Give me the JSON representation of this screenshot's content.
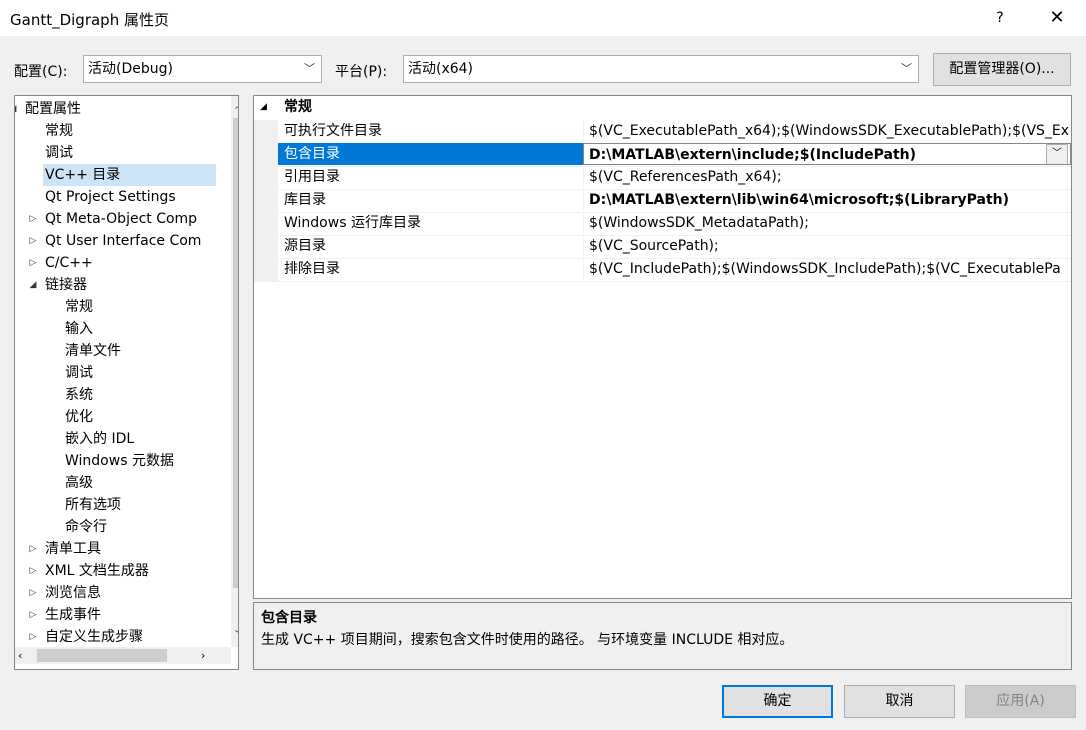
{
  "window": {
    "title": "Gantt_Digraph 属性页",
    "help": "?",
    "close": "✕"
  },
  "config": {
    "label": "配置(C):",
    "value": "活动(Debug)",
    "platform_label": "平台(P):",
    "platform_value": "活动(x64)",
    "manager_button": "配置管理器(O)..."
  },
  "tree": [
    {
      "label": "配置属性",
      "level": 0,
      "expander": "◢"
    },
    {
      "label": "常规",
      "level": 1,
      "expander": ""
    },
    {
      "label": "调试",
      "level": 1,
      "expander": ""
    },
    {
      "label": "VC++ 目录",
      "level": 1,
      "expander": "",
      "selected": true
    },
    {
      "label": "Qt Project Settings",
      "level": 1,
      "expander": ""
    },
    {
      "label": "Qt Meta-Object Comp",
      "level": 1,
      "expander": "▷"
    },
    {
      "label": "Qt User Interface Com",
      "level": 1,
      "expander": "▷"
    },
    {
      "label": "C/C++",
      "level": 1,
      "expander": "▷"
    },
    {
      "label": "链接器",
      "level": 1,
      "expander": "◢"
    },
    {
      "label": "常规",
      "level": 2,
      "expander": ""
    },
    {
      "label": "输入",
      "level": 2,
      "expander": ""
    },
    {
      "label": "清单文件",
      "level": 2,
      "expander": ""
    },
    {
      "label": "调试",
      "level": 2,
      "expander": ""
    },
    {
      "label": "系统",
      "level": 2,
      "expander": ""
    },
    {
      "label": "优化",
      "level": 2,
      "expander": ""
    },
    {
      "label": "嵌入的 IDL",
      "level": 2,
      "expander": ""
    },
    {
      "label": "Windows 元数据",
      "level": 2,
      "expander": ""
    },
    {
      "label": "高级",
      "level": 2,
      "expander": ""
    },
    {
      "label": "所有选项",
      "level": 2,
      "expander": ""
    },
    {
      "label": "命令行",
      "level": 2,
      "expander": ""
    },
    {
      "label": "清单工具",
      "level": 1,
      "expander": "▷"
    },
    {
      "label": "XML 文档生成器",
      "level": 1,
      "expander": "▷"
    },
    {
      "label": "浏览信息",
      "level": 1,
      "expander": "▷"
    },
    {
      "label": "生成事件",
      "level": 1,
      "expander": "▷"
    },
    {
      "label": "自定义生成步骤",
      "level": 1,
      "expander": "▷"
    }
  ],
  "grid": {
    "category": "常规",
    "category_toggle": "◢",
    "rows": [
      {
        "name": "可执行文件目录",
        "value": "$(VC_ExecutablePath_x64);$(WindowsSDK_ExecutablePath);$(VS_Ex",
        "bold": false
      },
      {
        "name": "包含目录",
        "value": "D:\\MATLAB\\extern\\include;$(IncludePath)",
        "bold": true,
        "selected": true
      },
      {
        "name": "引用目录",
        "value": "$(VC_ReferencesPath_x64);",
        "bold": false
      },
      {
        "name": "库目录",
        "value": "D:\\MATLAB\\extern\\lib\\win64\\microsoft;$(LibraryPath)",
        "bold": true
      },
      {
        "name": "Windows 运行库目录",
        "value": "$(WindowsSDK_MetadataPath);",
        "bold": false
      },
      {
        "name": "源目录",
        "value": "$(VC_SourcePath);",
        "bold": false
      },
      {
        "name": "排除目录",
        "value": "$(VC_IncludePath);$(WindowsSDK_IncludePath);$(VC_ExecutablePa",
        "bold": false
      }
    ]
  },
  "description": {
    "title": "包含目录",
    "text": "生成 VC++ 项目期间，搜索包含文件时使用的路径。 与环境变量 INCLUDE 相对应。"
  },
  "buttons": {
    "ok": "确定",
    "cancel": "取消",
    "apply": "应用(A)"
  },
  "colors": {
    "selection": "#0078d7",
    "tree_selection": "#cce4f7",
    "disabled_text": "#838383"
  }
}
